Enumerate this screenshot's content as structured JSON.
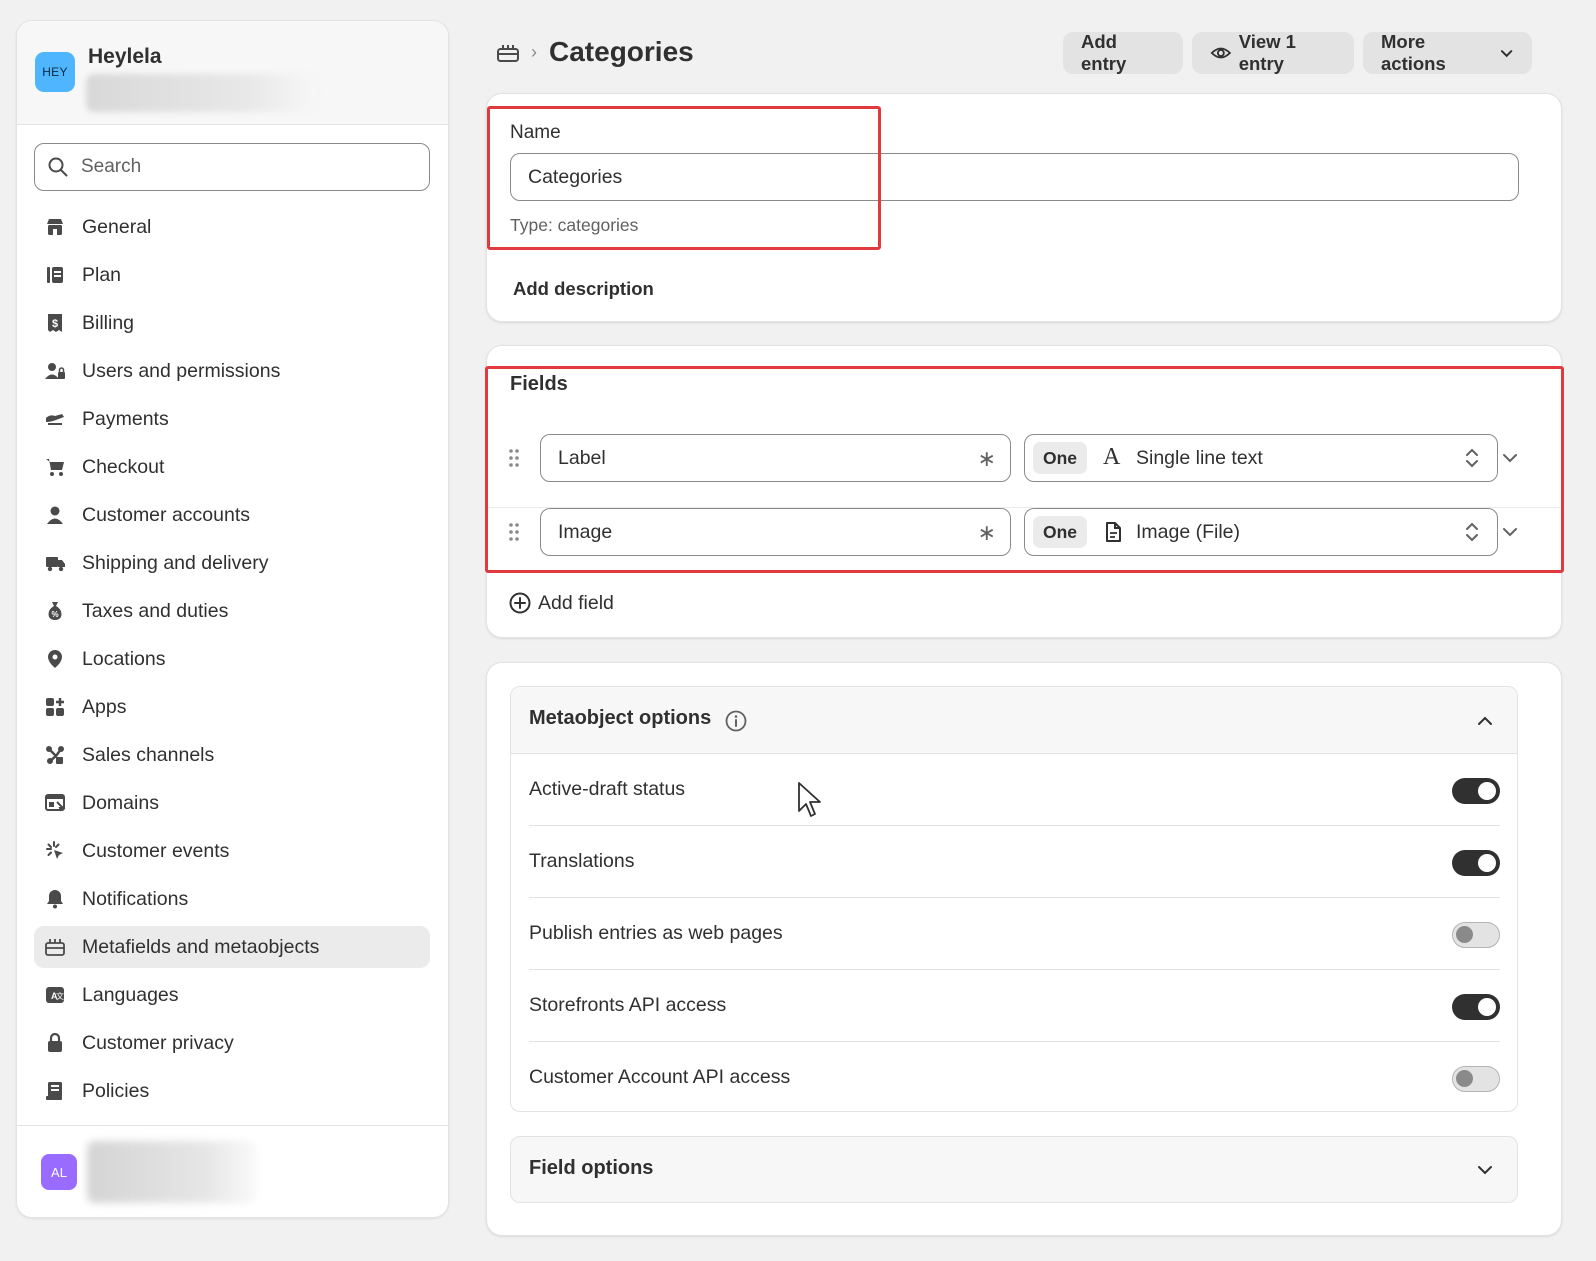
{
  "store": {
    "avatar_text": "HEY",
    "name": "Heylela"
  },
  "search": {
    "placeholder": "Search"
  },
  "nav": {
    "items": [
      {
        "label": "General",
        "icon": "store-icon"
      },
      {
        "label": "Plan",
        "icon": "plan-icon"
      },
      {
        "label": "Billing",
        "icon": "billing-icon"
      },
      {
        "label": "Users and permissions",
        "icon": "users-icon"
      },
      {
        "label": "Payments",
        "icon": "payments-icon"
      },
      {
        "label": "Checkout",
        "icon": "cart-icon"
      },
      {
        "label": "Customer accounts",
        "icon": "person-icon"
      },
      {
        "label": "Shipping and delivery",
        "icon": "truck-icon"
      },
      {
        "label": "Taxes and duties",
        "icon": "tax-icon"
      },
      {
        "label": "Locations",
        "icon": "location-icon"
      },
      {
        "label": "Apps",
        "icon": "apps-icon"
      },
      {
        "label": "Sales channels",
        "icon": "channels-icon"
      },
      {
        "label": "Domains",
        "icon": "domains-icon"
      },
      {
        "label": "Customer events",
        "icon": "events-icon"
      },
      {
        "label": "Notifications",
        "icon": "bell-icon"
      },
      {
        "label": "Metafields and metaobjects",
        "icon": "metaobject-icon",
        "active": true
      },
      {
        "label": "Languages",
        "icon": "languages-icon"
      },
      {
        "label": "Customer privacy",
        "icon": "lock-icon"
      },
      {
        "label": "Policies",
        "icon": "policies-icon"
      }
    ]
  },
  "user": {
    "avatar_text": "AL"
  },
  "header": {
    "title": "Categories",
    "add_entry": "Add entry",
    "view_entry": "View 1 entry",
    "more_actions": "More actions"
  },
  "definition": {
    "name_label": "Name",
    "name_value": "Categories",
    "type_text": "Type: categories",
    "add_description": "Add description"
  },
  "fields": {
    "title": "Fields",
    "rows": [
      {
        "name": "Label",
        "cardinality": "One",
        "type": "Single line text",
        "type_icon": "text-type-icon"
      },
      {
        "name": "Image",
        "cardinality": "One",
        "type": "Image (File)",
        "type_icon": "file-icon"
      }
    ],
    "add_field": "Add field"
  },
  "metaobject_options": {
    "title": "Metaobject options",
    "rows": [
      {
        "label": "Active-draft status",
        "enabled": true
      },
      {
        "label": "Translations",
        "enabled": true
      },
      {
        "label": "Publish entries as web pages",
        "enabled": false
      },
      {
        "label": "Storefronts API access",
        "enabled": true
      },
      {
        "label": "Customer Account API access",
        "enabled": false
      }
    ]
  },
  "field_options": {
    "title": "Field options"
  },
  "colors": {
    "highlight": "#e03a3e",
    "toggle_on": "#303030",
    "store_avatar": "#4fb5ff",
    "user_avatar": "#9a6bff"
  }
}
